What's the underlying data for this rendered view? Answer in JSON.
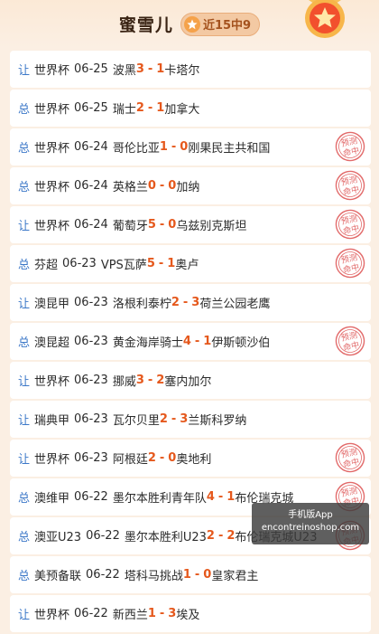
{
  "header": {
    "title": "蜜雪儿",
    "streak": "近15中9"
  },
  "rows": [
    {
      "type": "让",
      "league": "世界杯",
      "date": "06-25",
      "home": "波黑",
      "hs": "3",
      "as": "1",
      "away": "卡塔尔",
      "hit": false
    },
    {
      "type": "总",
      "league": "世界杯",
      "date": "06-25",
      "home": "瑞士",
      "hs": "2",
      "as": "1",
      "away": "加拿大",
      "hit": false
    },
    {
      "type": "总",
      "league": "世界杯",
      "date": "06-24",
      "home": "哥伦比亚",
      "hs": "1",
      "as": "0",
      "away": "刚果民主共和国",
      "hit": true
    },
    {
      "type": "总",
      "league": "世界杯",
      "date": "06-24",
      "home": "英格兰",
      "hs": "0",
      "as": "0",
      "away": "加纳",
      "hit": true
    },
    {
      "type": "让",
      "league": "世界杯",
      "date": "06-24",
      "home": "葡萄牙",
      "hs": "5",
      "as": "0",
      "away": "乌兹别克斯坦",
      "hit": true
    },
    {
      "type": "总",
      "league": "芬超",
      "date": "06-23",
      "home": "VPS瓦萨",
      "hs": "5",
      "as": "1",
      "away": "奥卢",
      "hit": true
    },
    {
      "type": "让",
      "league": "澳昆甲",
      "date": "06-23",
      "home": "洛根利泰柠",
      "hs": "2",
      "as": "3",
      "away": "荷兰公园老鹰",
      "hit": false
    },
    {
      "type": "总",
      "league": "澳昆超",
      "date": "06-23",
      "home": "黄金海岸骑士",
      "hs": "4",
      "as": "1",
      "away": "伊斯顿沙伯",
      "hit": true
    },
    {
      "type": "让",
      "league": "世界杯",
      "date": "06-23",
      "home": "挪威",
      "hs": "3",
      "as": "2",
      "away": "塞内加尔",
      "hit": false
    },
    {
      "type": "让",
      "league": "瑞典甲",
      "date": "06-23",
      "home": "瓦尔贝里",
      "hs": "2",
      "as": "3",
      "away": "兰斯科罗纳",
      "hit": false
    },
    {
      "type": "让",
      "league": "世界杯",
      "date": "06-23",
      "home": "阿根廷",
      "hs": "2",
      "as": "0",
      "away": "奥地利",
      "hit": true
    },
    {
      "type": "总",
      "league": "澳维甲",
      "date": "06-22",
      "home": "墨尔本胜利青年队",
      "hs": "4",
      "as": "1",
      "away": "布伦瑞克城",
      "hit": true
    },
    {
      "type": "总",
      "league": "澳亚U23",
      "date": "06-22",
      "home": "墨尔本胜利U23",
      "hs": "2",
      "as": "2",
      "away": "布伦瑞克城U23",
      "hit": true
    },
    {
      "type": "总",
      "league": "美预备联",
      "date": "06-22",
      "home": "塔科马挑战",
      "hs": "1",
      "as": "0",
      "away": "皇家君主",
      "hit": false
    },
    {
      "type": "让",
      "league": "世界杯",
      "date": "06-22",
      "home": "新西兰",
      "hs": "1",
      "as": "3",
      "away": "埃及",
      "hit": false
    }
  ],
  "stamp": {
    "line1": "预测",
    "line2": "命中"
  },
  "watermark": {
    "line1": "手机版App",
    "line2": "encontreinoshop.com"
  },
  "colors": {
    "type_blue": "#3c78c8",
    "score_orange": "#e5581c",
    "stamp_red": "#e26a6a"
  }
}
